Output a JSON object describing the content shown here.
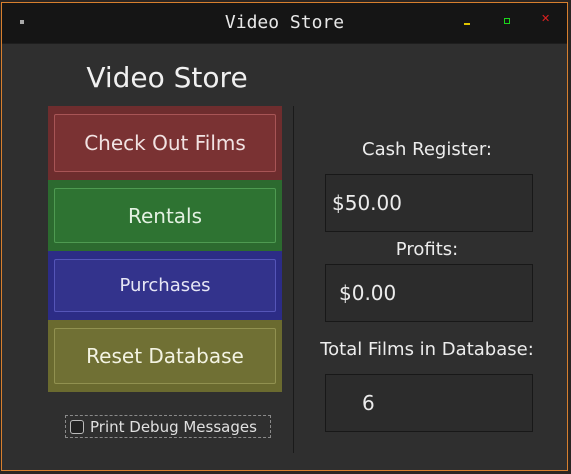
{
  "window": {
    "title": "Video Store"
  },
  "main": {
    "heading": "Video Store",
    "buttons": {
      "check_out": "Check Out Films",
      "rentals": "Rentals",
      "purchases": "Purchases",
      "reset": "Reset Database"
    },
    "debug_checkbox": {
      "label": "Print Debug Messages",
      "checked": false
    }
  },
  "stats": {
    "cash_register": {
      "label": "Cash Register:",
      "value": "$50.00"
    },
    "profits": {
      "label": "Profits:",
      "value": "$0.00"
    },
    "total_films": {
      "label": "Total Films in Database:",
      "value": "6"
    }
  },
  "colors": {
    "window_border": "#d77f2e",
    "check_out_bg": "#6e2d2e",
    "rentals_bg": "#2c6a2f",
    "purchases_bg": "#2c2c86",
    "reset_bg": "#6a6a2f"
  }
}
